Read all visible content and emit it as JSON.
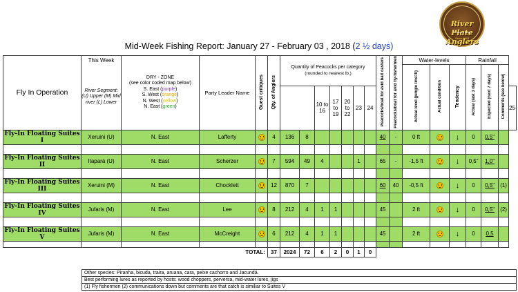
{
  "logo": {
    "name": "River Plate Anglers",
    "tagline": "Peacock bass",
    "est": "Since 1993"
  },
  "title": {
    "main": "Mid-Week Fishing Report: January 27 - February 03 , 2018 (",
    "days": "2 ½ days",
    "end": ")"
  },
  "headers": {
    "fly_in": "Fly In Operation",
    "this_week": "This Week",
    "river_segment": "River Segment: (U) Upper (M) Mid river (L) Lower",
    "dry_zone": "DRY - ZONE",
    "zone_note": "(see color coded map below)",
    "zones": [
      {
        "label": "S. East (",
        "color": "purple",
        "end": ")"
      },
      {
        "label": "S. West (",
        "color": "orange",
        "end": ")"
      },
      {
        "label": "N. West (",
        "color": "yellow",
        "end": ")"
      },
      {
        "label": "N. East (",
        "color": "green",
        "end": ")"
      }
    ],
    "party_leader": "Party Leader Name",
    "guest_critiques": "Guest critiques",
    "qty_anglers": "Qty. of Anglers",
    "quantity": "Quantity of Peacocks per category",
    "rounded": "(rounded to nearest lb.)",
    "cats": [
      "10 to 16",
      "17 to 19",
      "20 to 22",
      "23",
      "24",
      "25+"
    ],
    "per_boat_avid": "Peacocks/boat for avid bait casters",
    "per_boat_fly": "Peacocks/boat for avid fly-fishermen",
    "water_levels": "Water-levels",
    "actual_level": "Actual level (jungle line=0)",
    "actual_condition": "Actual condition",
    "tendency": "Tendency",
    "rainfall": "Rainfall",
    "rain_actual": "Actual (last 3 days)",
    "rain_expected": "Expected (next 7 days)",
    "comments": "Comments (see below)"
  },
  "rows": [
    {
      "name": "Fly-In Floating Suites I",
      "segment": "Xeruini (U)",
      "zone": "N. East",
      "leader": "Lafferty",
      "anglers": "4",
      "cat1": "136",
      "cat2": "8",
      "cat3": "",
      "cat4": "",
      "cat5": "",
      "cat6": "",
      "avid": "40",
      "fly": "-",
      "level": "0 ft",
      "rain_actual": "0",
      "rain_expected": "0,5\"",
      "comment": ""
    },
    {
      "name": "Fly-In Floating Suites II",
      "segment": "Itapará (U)",
      "zone": "N. East",
      "leader": "Scherzer",
      "anglers": "7",
      "cat1": "594",
      "cat2": "49",
      "cat3": "4",
      "cat4": "",
      "cat5": "",
      "cat6": "1",
      "avid": "65",
      "fly": "-",
      "level": "-1,5 ft",
      "rain_actual": "0,5\"",
      "rain_expected": "1,0\"",
      "comment": ""
    },
    {
      "name": "Fly-In Floating Suites III",
      "segment": "Xeruini (M)",
      "zone": "N. East",
      "leader": "Chocklett",
      "anglers": "12",
      "cat1": "870",
      "cat2": "7",
      "cat3": "",
      "cat4": "",
      "cat5": "",
      "cat6": "",
      "avid": "60",
      "fly": "40",
      "level": "-0,5 ft",
      "rain_actual": "0",
      "rain_expected": "0,5\"",
      "comment": "(1)"
    },
    {
      "name": "Fly-In Floating Suites IV",
      "segment": "Jufaris (M)",
      "zone": "N. East",
      "leader": "Lee",
      "anglers": "8",
      "cat1": "212",
      "cat2": "4",
      "cat3": "1",
      "cat4": "1",
      "cat5": "",
      "cat6": "",
      "avid": "45",
      "fly": "",
      "level": "2 ft",
      "rain_actual": "0",
      "rain_expected": "0,5\"",
      "comment": "(2)"
    },
    {
      "name": "Fly-In Floating Suites V",
      "segment": "Jufaris (M)",
      "zone": "N. East",
      "leader": "McCreight",
      "anglers": "6",
      "cat1": "212",
      "cat2": "4",
      "cat3": "1",
      "cat4": "1",
      "cat5": "",
      "cat6": "",
      "avid": "45",
      "fly": "",
      "level": "2 ft",
      "rain_actual": "0",
      "rain_expected": "0,5",
      "comment": ""
    }
  ],
  "totals": {
    "label": "TOTAL:",
    "anglers": "37",
    "cat1": "2024",
    "cat2": "72",
    "cat3": "6",
    "cat4": "2",
    "cat5": "0",
    "cat6": "1",
    "cat7": "0"
  },
  "notes": [
    "Other species: Piranha, bicuda, traira, aruana, cara, peixe cachorro and Jacundá.",
    "Best performing lures as reported by hosts: wood choppers, perversa, mid-water lures,   jigs",
    "(1) Fly fishermen  (2) communications down but comments are that catch is similiar to Suites V"
  ],
  "colors": {
    "row_green": "#9fdc67",
    "title_blue": "#1f3fbf"
  }
}
